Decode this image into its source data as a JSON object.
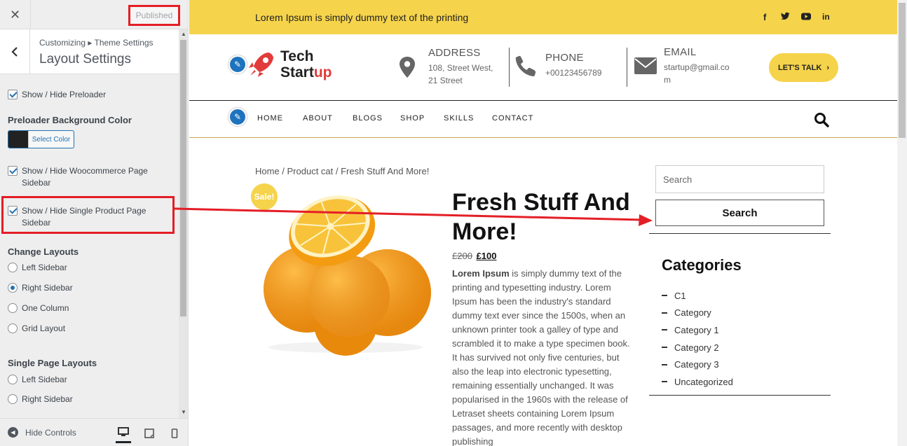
{
  "customizer": {
    "close_icon": "✕",
    "publish_label": "Published",
    "breadcrumb": "Customizing ▸ Theme Settings",
    "title": "Layout Settings",
    "back_icon": "‹",
    "options": {
      "preloader": "Show / Hide Preloader",
      "preloader_bg": "Preloader Background Color",
      "select_color": "Select Color",
      "woo_sidebar_line1": "Show / Hide Woocommerce Page",
      "woo_sidebar_line2": "Sidebar",
      "single_sidebar_line1": "Show / Hide Single Product Page",
      "single_sidebar_line2": "Sidebar"
    },
    "change_layouts": {
      "heading": "Change Layouts",
      "options": [
        "Left Sidebar",
        "Right Sidebar",
        "One Column",
        "Grid Layout"
      ],
      "selected": "Right Sidebar"
    },
    "single_layouts": {
      "heading": "Single Page Layouts",
      "options": [
        "Left Sidebar",
        "Right Sidebar"
      ]
    },
    "hide_controls": "Hide Controls",
    "colors": {
      "accent": "#2271b1",
      "highlight": "#e41e26"
    }
  },
  "site": {
    "topbar_text": "Lorem Ipsum is simply dummy text of the printing",
    "social_icons": [
      "facebook-icon",
      "twitter-icon",
      "youtube-icon",
      "linkedin-icon"
    ],
    "logo_line1": "Tech",
    "logo_line2a": "Start",
    "logo_line2b": "up",
    "address": {
      "label": "ADDRESS",
      "line1": "108, Street West,",
      "line2": "21 Street"
    },
    "phone": {
      "label": "PHONE",
      "value": "+00123456789"
    },
    "email": {
      "label": "EMAIL",
      "line1": "startup@gmail.co",
      "line2": "m"
    },
    "cta": "LET'S TALK",
    "nav": [
      "HOME",
      "ABOUT",
      "BLOGS",
      "SHOP",
      "SKILLS",
      "CONTACT"
    ],
    "breadcrumb": "Home / Product cat / Fresh Stuff And More!",
    "sale_badge": "Sale!",
    "product_title": "Fresh Stuff And More!",
    "price_old": "£200",
    "price_new": "£100",
    "desc_bold": "Lorem Ipsum",
    "desc_rest": " is simply dummy text of the printing and typesetting industry. Lorem Ipsum has been the industry's standard dummy text ever since the 1500s, when an unknown printer took a galley of type and scrambled it to make a type specimen book. It has survived not only five centuries, but also the leap into electronic typesetting, remaining essentially unchanged. It was popularised in the 1960s with the release of Letraset sheets containing Lorem Ipsum passages, and more recently with desktop publishing",
    "search_placeholder": "Search",
    "search_button": "Search",
    "categories_heading": "Categories",
    "categories": [
      "C1",
      "Category",
      "Category 1",
      "Category 2",
      "Category 3",
      "Uncategorized"
    ],
    "colors": {
      "yellow": "#f5d34b",
      "red": "#e23b3b",
      "blue": "#1e73be"
    }
  }
}
